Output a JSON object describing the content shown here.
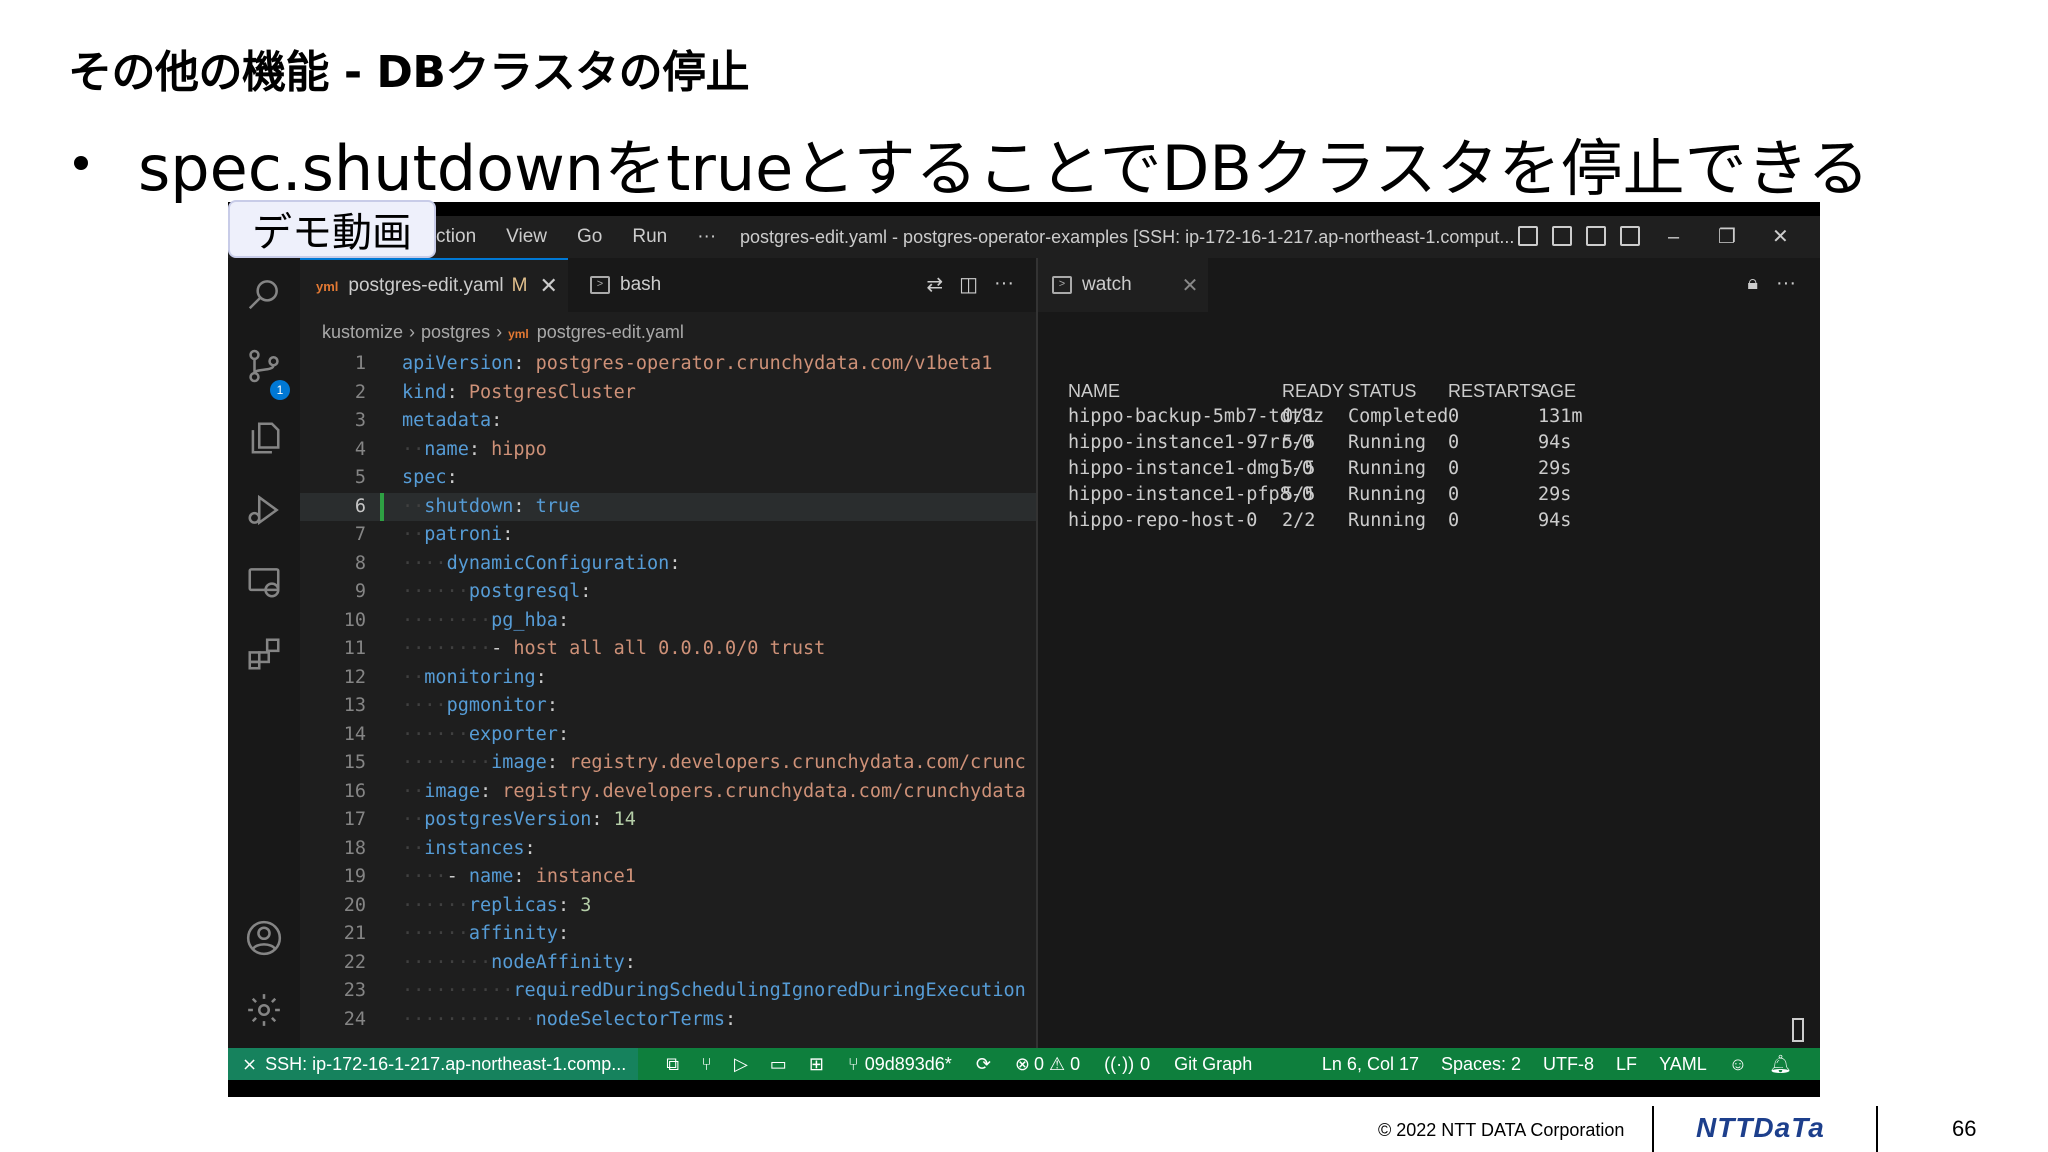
{
  "slide": {
    "title": "その他の機能 - DBクラスタの停止",
    "bullet": "spec.shutdownをtrueとすることでDBクラスタを停止できる",
    "demo_label": "デモ動画",
    "copyright": "© 2022 NTT DATA Corporation",
    "logo": "NTTDaTa",
    "page_number": "66"
  },
  "window": {
    "menu": [
      "ction",
      "View",
      "Go",
      "Run",
      "···"
    ],
    "title": "postgres-edit.yaml - postgres-operator-examples [SSH: ip-172-16-1-217.ap-northeast-1.comput...",
    "controls": {
      "minimize": "–",
      "restore": "❐",
      "close": "✕"
    }
  },
  "activity_bar": {
    "items": [
      "search-icon",
      "source-control-icon",
      "explorer-icon",
      "run-debug-icon",
      "remote-explorer-icon",
      "extensions-icon",
      "account-icon",
      "settings-icon"
    ],
    "source_control_badge": "1"
  },
  "editor": {
    "tabs": [
      {
        "label": "postgres-edit.yaml",
        "icon": "yaml-icon",
        "modified": "M",
        "close": "✕"
      },
      {
        "label": "bash",
        "icon": "terminal-icon"
      }
    ],
    "breadcrumb": [
      "kustomize",
      "postgres",
      "postgres-edit.yaml"
    ],
    "cursor_line": 6,
    "lines": [
      {
        "n": "1",
        "indent": "",
        "key": "apiVersion",
        "sep": ": ",
        "val": "postgres-operator.crunchydata.com/v1beta1",
        "vtype": "v"
      },
      {
        "n": "2",
        "indent": "",
        "key": "kind",
        "sep": ": ",
        "val": "PostgresCluster",
        "vtype": "v"
      },
      {
        "n": "3",
        "indent": "",
        "key": "metadata",
        "sep": ":",
        "val": "",
        "vtype": "v"
      },
      {
        "n": "4",
        "indent": "··",
        "key": "name",
        "sep": ": ",
        "val": "hippo",
        "vtype": "v"
      },
      {
        "n": "5",
        "indent": "",
        "key": "spec",
        "sep": ":",
        "val": "",
        "vtype": "v"
      },
      {
        "n": "6",
        "indent": "··",
        "key": "shutdown",
        "sep": ": ",
        "val": "true",
        "vtype": "k"
      },
      {
        "n": "7",
        "indent": "··",
        "key": "patroni",
        "sep": ":",
        "val": "",
        "vtype": "v"
      },
      {
        "n": "8",
        "indent": "····",
        "key": "dynamicConfiguration",
        "sep": ":",
        "val": "",
        "vtype": "v"
      },
      {
        "n": "9",
        "indent": "······",
        "key": "postgresql",
        "sep": ":",
        "val": "",
        "vtype": "v"
      },
      {
        "n": "10",
        "indent": "········",
        "key": "pg_hba",
        "sep": ":",
        "val": "",
        "vtype": "v"
      },
      {
        "n": "11",
        "indent": "········",
        "key": "",
        "sep": "- ",
        "val": "host all all 0.0.0.0/0 trust",
        "vtype": "v"
      },
      {
        "n": "12",
        "indent": "··",
        "key": "monitoring",
        "sep": ":",
        "val": "",
        "vtype": "v"
      },
      {
        "n": "13",
        "indent": "····",
        "key": "pgmonitor",
        "sep": ":",
        "val": "",
        "vtype": "v"
      },
      {
        "n": "14",
        "indent": "······",
        "key": "exporter",
        "sep": ":",
        "val": "",
        "vtype": "v"
      },
      {
        "n": "15",
        "indent": "········",
        "key": "image",
        "sep": ": ",
        "val": "registry.developers.crunchydata.com/crunc",
        "vtype": "v"
      },
      {
        "n": "16",
        "indent": "··",
        "key": "image",
        "sep": ": ",
        "val": "registry.developers.crunchydata.com/crunchydata",
        "vtype": "v"
      },
      {
        "n": "17",
        "indent": "··",
        "key": "postgresVersion",
        "sep": ": ",
        "val": "14",
        "vtype": "n"
      },
      {
        "n": "18",
        "indent": "··",
        "key": "instances",
        "sep": ":",
        "val": "",
        "vtype": "v"
      },
      {
        "n": "19",
        "indent": "····",
        "key": "",
        "sep": "- ",
        "val": "",
        "vtype": "v",
        "key2": "name",
        "val2": "instance1"
      },
      {
        "n": "20",
        "indent": "······",
        "key": "replicas",
        "sep": ": ",
        "val": "3",
        "vtype": "n"
      },
      {
        "n": "21",
        "indent": "······",
        "key": "affinity",
        "sep": ":",
        "val": "",
        "vtype": "v"
      },
      {
        "n": "22",
        "indent": "········",
        "key": "nodeAffinity",
        "sep": ":",
        "val": "",
        "vtype": "v"
      },
      {
        "n": "23",
        "indent": "··········",
        "key": "requiredDuringSchedulingIgnoredDuringExecution",
        "sep": "",
        "val": "",
        "vtype": "v"
      },
      {
        "n": "24",
        "indent": "············",
        "key": "nodeSelectorTerms",
        "sep": ":",
        "val": "",
        "vtype": "v"
      }
    ]
  },
  "terminal": {
    "tab_label": "watch",
    "tab_close": "✕",
    "headers": [
      "NAME",
      "READY",
      "STATUS",
      "RESTARTS",
      "AGE"
    ],
    "rows": [
      [
        "hippo-backup-5mb7-tdt8z",
        "0/1",
        "Completed",
        "0",
        "131m"
      ],
      [
        "hippo-instance1-97rr-0",
        "5/5",
        "Running",
        "0",
        "94s"
      ],
      [
        "hippo-instance1-dmgl-0",
        "5/5",
        "Running",
        "0",
        "29s"
      ],
      [
        "hippo-instance1-pfp8-0",
        "5/5",
        "Running",
        "0",
        "29s"
      ],
      [
        "hippo-repo-host-0",
        "2/2",
        "Running",
        "0",
        "94s"
      ]
    ]
  },
  "status_bar": {
    "remote": "SSH: ip-172-16-1-217.ap-northeast-1.comp...",
    "branch": "09d893d6*",
    "problems": "0 ⚠ 0",
    "ports": "0",
    "git_graph": "Git Graph",
    "position": "Ln 6, Col 17",
    "spaces": "Spaces: 2",
    "encoding": "UTF-8",
    "eol": "LF",
    "language": "YAML",
    "bg_color": "#0e7f3d"
  }
}
